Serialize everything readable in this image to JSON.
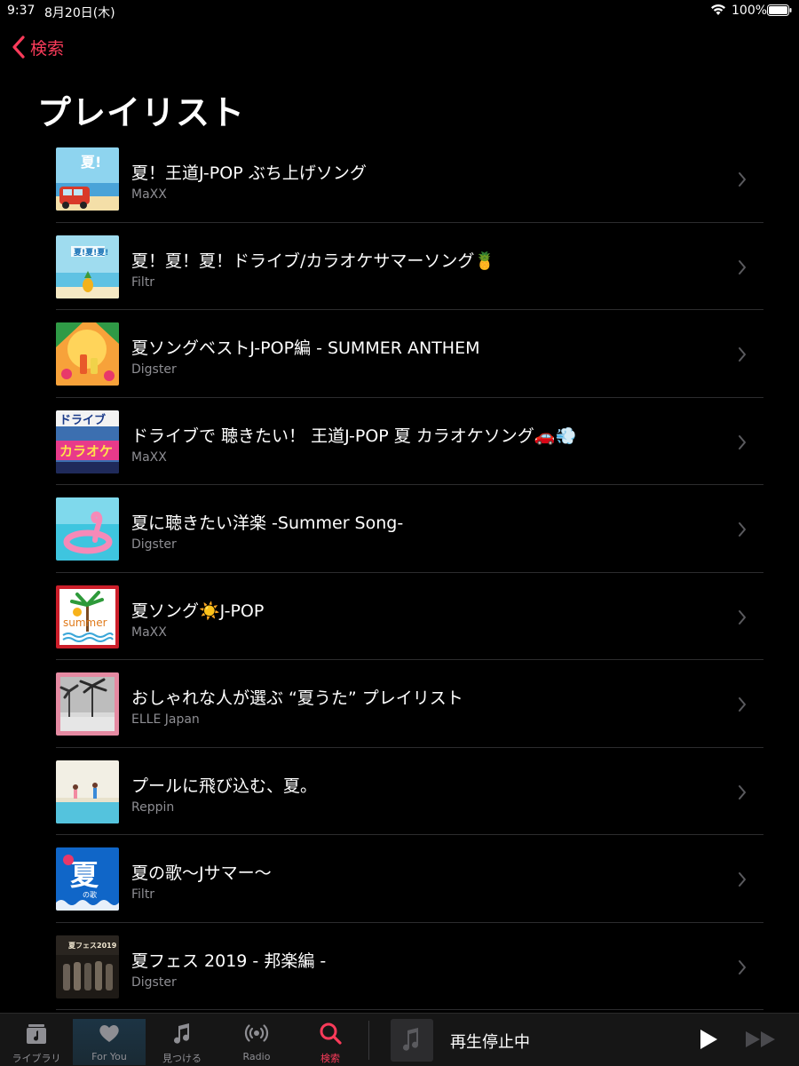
{
  "status_bar": {
    "time": "9:37",
    "date": "8月20日(木)",
    "battery": "100%"
  },
  "nav": {
    "back_label": "検索"
  },
  "page_title": "プレイリスト",
  "playlists": [
    {
      "title": "夏！王道J-POP ぶち上げソング",
      "curator": "MaXX",
      "art": "summer-van"
    },
    {
      "title": "夏！夏！夏！ドライブ/カラオケサマーソング🍍",
      "curator": "Filtr",
      "art": "pineapple-beach"
    },
    {
      "title": "夏ソングベストJ-POP編 - SUMMER ANTHEM",
      "curator": "Digster",
      "art": "tropical-drinks"
    },
    {
      "title": "ドライブで 聴きたい！ 王道J-POP 夏 カラオケソング🚗💨",
      "curator": "MaXX",
      "art": "drive-karaoke"
    },
    {
      "title": "夏に聴きたい洋楽 -Summer Song-",
      "curator": "Digster",
      "art": "flamingo-pool"
    },
    {
      "title": "夏ソング☀️J-POP",
      "curator": "MaXX",
      "art": "summer-palm"
    },
    {
      "title": "おしゃれな人が選ぶ “夏うた” プレイリスト",
      "curator": "ELLE Japan",
      "art": "elle-palms"
    },
    {
      "title": "プールに飛び込む、夏。",
      "curator": "Reppin",
      "art": "pool-jump"
    },
    {
      "title": "夏の歌〜Jサマー〜",
      "curator": "Filtr",
      "art": "natsu-blue"
    },
    {
      "title": "夏フェス 2019 - 邦楽編 -",
      "curator": "Digster",
      "art": "natsufes-band"
    }
  ],
  "tabs": [
    {
      "label": "ライブラリ",
      "icon": "library-icon"
    },
    {
      "label": "For You",
      "icon": "heart-icon"
    },
    {
      "label": "見つける",
      "icon": "music-note-icon"
    },
    {
      "label": "Radio",
      "icon": "radio-icon"
    },
    {
      "label": "検索",
      "icon": "search-icon",
      "active": true
    }
  ],
  "mini_player": {
    "status": "再生停止中"
  },
  "colors": {
    "accent": "#fa3b5a",
    "background": "#000000",
    "secondary_text": "#8e8e93"
  }
}
